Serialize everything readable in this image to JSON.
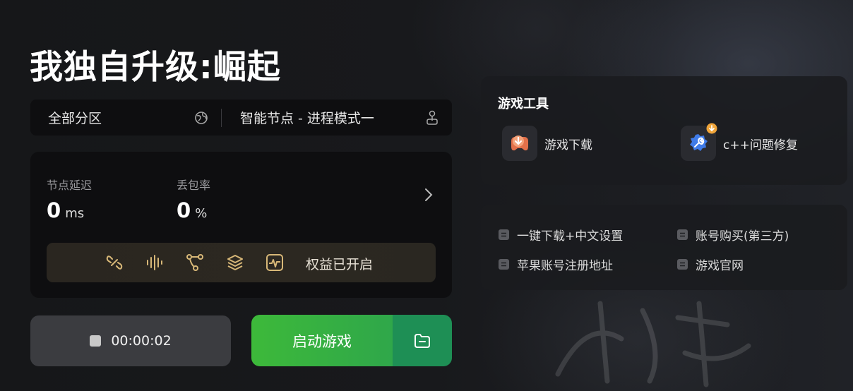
{
  "game_title": "我独自升级:崛起",
  "region_bar": {
    "region_label": "全部分区",
    "node_label": "智能节点 - 进程模式一"
  },
  "stats": {
    "latency_label": "节点延迟",
    "latency_value": "0",
    "latency_unit": "ms",
    "loss_label": "丢包率",
    "loss_value": "0",
    "loss_unit": "%"
  },
  "perks": {
    "status_text": "权益已开启",
    "icons": [
      "link-icon",
      "waveform-icon",
      "route-icon",
      "layers-icon",
      "monitor-icon"
    ]
  },
  "timer": {
    "elapsed": "00:00:02"
  },
  "launch": {
    "label": "启动游戏"
  },
  "tools": {
    "title": "游戏工具",
    "items": [
      {
        "label": "游戏下载",
        "icon": "game-download-icon"
      },
      {
        "label": "c++问题修复",
        "icon": "cpp-repair-icon"
      }
    ]
  },
  "links": {
    "items": [
      {
        "label": "一键下载+中文设置"
      },
      {
        "label": "账号购买(第三方)"
      },
      {
        "label": "苹果账号注册地址"
      },
      {
        "label": "游戏官网"
      }
    ]
  },
  "colors": {
    "launch_green": "#3db93a",
    "launch_side": "#1e8f55",
    "panel_bg": "#0e0e10",
    "accent_orange": "#f0a53a"
  }
}
